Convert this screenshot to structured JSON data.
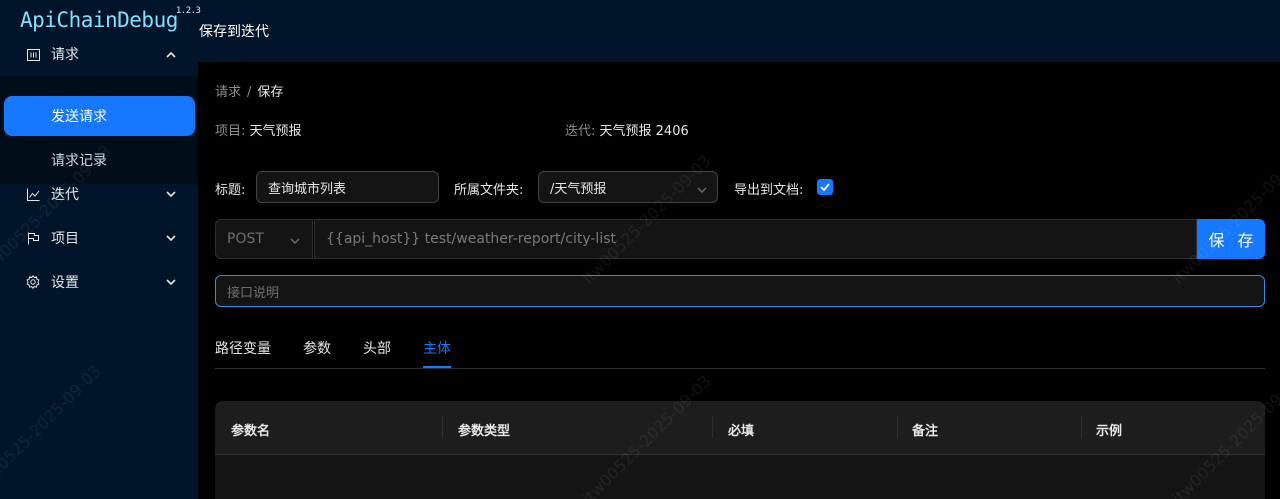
{
  "app": {
    "logo": "ApiChainDebug",
    "version": "1.2.3",
    "page_title": "保存到迭代"
  },
  "sidebar": {
    "requests": {
      "label": "请求",
      "children": [
        {
          "label": "发送请求"
        },
        {
          "label": "请求记录"
        }
      ]
    },
    "items": [
      {
        "label": "迭代"
      },
      {
        "label": "项目"
      },
      {
        "label": "设置"
      }
    ]
  },
  "breadcrumb": {
    "parent": "请求",
    "separator": "/",
    "current": "保存"
  },
  "info": {
    "project_label": "项目:",
    "project_value": "天气预报",
    "iteration_label": "迭代:",
    "iteration_value": "天气预报 2406"
  },
  "form": {
    "title_label": "标题:",
    "title_value": "查询城市列表",
    "folder_label": "所属文件夹:",
    "folder_value": "/天气预报",
    "export_label": "导出到文档:",
    "export_checked": true,
    "method": "POST",
    "url": "{{api_host}} test/weather-report/city-list",
    "save_label": "保 存",
    "desc_placeholder": "接口说明"
  },
  "tabs": [
    {
      "label": "路径变量"
    },
    {
      "label": "参数"
    },
    {
      "label": "头部"
    },
    {
      "label": "主体",
      "active": true
    }
  ],
  "table": {
    "columns": [
      "参数名",
      "参数类型",
      "必填",
      "备注",
      "示例"
    ]
  },
  "watermark": "itw00525-2025-09-03",
  "colors": {
    "accent": "#1677ff",
    "sidebar": "#001529",
    "background": "#000000"
  }
}
